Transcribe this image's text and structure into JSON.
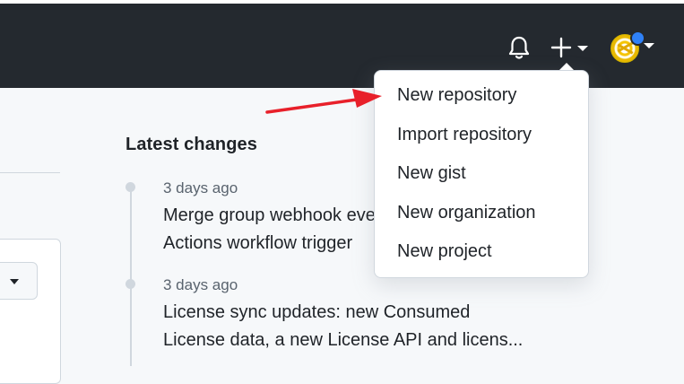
{
  "header": {
    "notifications_icon": "bell-icon",
    "create_icon": "plus-icon",
    "create_caret_icon": "caret-down-icon",
    "avatar_caret_icon": "caret-down-icon",
    "colors": {
      "background": "#24292f",
      "icon": "#ffffff",
      "status_dot": "#2f81f7"
    }
  },
  "dropdown": {
    "items": [
      {
        "label": "New repository"
      },
      {
        "label": "Import repository"
      },
      {
        "label": "New gist"
      },
      {
        "label": "New organization"
      },
      {
        "label": "New project"
      }
    ]
  },
  "latest_changes": {
    "title": "Latest changes",
    "entries": [
      {
        "date": "3 days ago",
        "line1": "Merge group webhook event and GitHub",
        "line2": "Actions workflow trigger"
      },
      {
        "date": "3 days ago",
        "line1": "License sync updates: new Consumed",
        "line2": "License data, a new License API and licens..."
      }
    ]
  },
  "annotation": {
    "icon": "red-arrow-icon",
    "color": "#e8202a"
  }
}
